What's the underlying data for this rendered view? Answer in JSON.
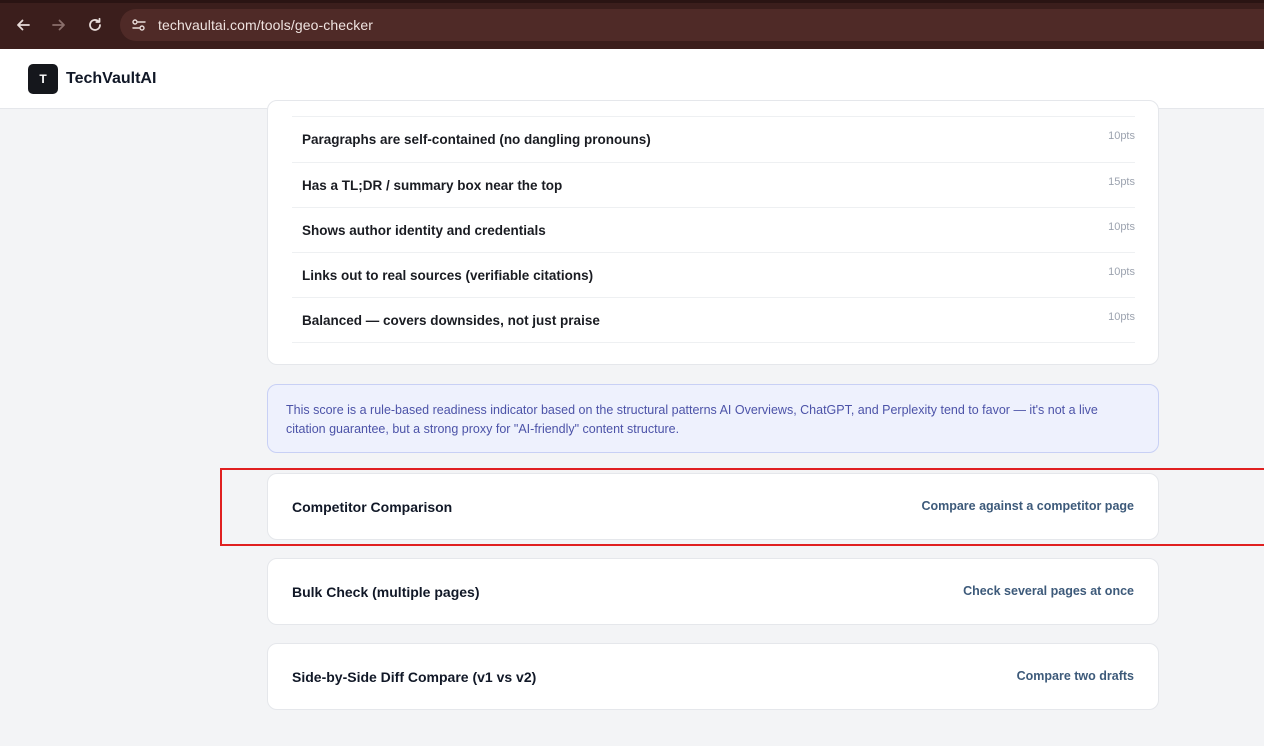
{
  "browser": {
    "url": "techvaultai.com/tools/geo-checker"
  },
  "header": {
    "logo_letter": "T",
    "brand": "TechVaultAI"
  },
  "checklist": [
    {
      "label": "Paragraphs are self-contained (no dangling pronouns)",
      "points": "10pts"
    },
    {
      "label": "Has a TL;DR / summary box near the top",
      "points": "15pts"
    },
    {
      "label": "Shows author identity and credentials",
      "points": "10pts"
    },
    {
      "label": "Links out to real sources (verifiable citations)",
      "points": "10pts"
    },
    {
      "label": "Balanced — covers downsides, not just praise",
      "points": "10pts"
    }
  ],
  "note": "This score is a rule-based readiness indicator based on the structural patterns AI Overviews, ChatGPT, and Perplexity tend to favor — it's not a live citation guarantee, but a strong proxy for \"AI-friendly\" content structure.",
  "features": [
    {
      "title": "Competitor Comparison",
      "action": "Compare against a competitor page"
    },
    {
      "title": "Bulk Check (multiple pages)",
      "action": "Check several pages at once"
    },
    {
      "title": "Side-by-Side Diff Compare (v1 vs v2)",
      "action": "Compare two drafts"
    }
  ],
  "colors": {
    "highlight": "#e02020",
    "link": "#3d5a7a",
    "note_bg": "#eef1fd"
  }
}
